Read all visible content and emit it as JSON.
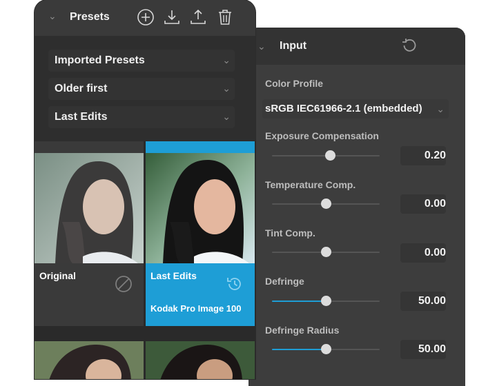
{
  "presets": {
    "title": "Presets",
    "header_icons": [
      "add-circle-icon",
      "import-icon",
      "export-icon",
      "trash-icon"
    ],
    "filters": [
      {
        "label": "Imported Presets"
      },
      {
        "label": "Older first"
      },
      {
        "label": "Last Edits"
      }
    ],
    "tiles": [
      {
        "name": "Original",
        "subtitle": "",
        "selected": false,
        "icon": "prohibited-icon"
      },
      {
        "name": "Last Edits",
        "subtitle": "Kodak Pro Image 100",
        "selected": true,
        "icon": "history-icon"
      }
    ]
  },
  "input": {
    "title": "Input",
    "color_profile_label": "Color Profile",
    "color_profile_value": "sRGB IEC61966-2.1 (embedded)",
    "sliders": [
      {
        "label": "Exposure Compensation",
        "value": "0.20",
        "level": 0.54,
        "filled": false
      },
      {
        "label": "Temperature Comp.",
        "value": "0.00",
        "level": 0.5,
        "filled": false
      },
      {
        "label": "Tint Comp.",
        "value": "0.00",
        "level": 0.5,
        "filled": false
      },
      {
        "label": "Defringe",
        "value": "50.00",
        "level": 0.5,
        "filled": true
      },
      {
        "label": "Defringe Radius",
        "value": "50.00",
        "level": 0.5,
        "filled": true
      }
    ]
  },
  "colors": {
    "panel_bg": "#3a3a3a",
    "selected_tile": "#1e9ed6",
    "slider_fill": "#1e9ed6",
    "text": "#f2f2f2"
  }
}
